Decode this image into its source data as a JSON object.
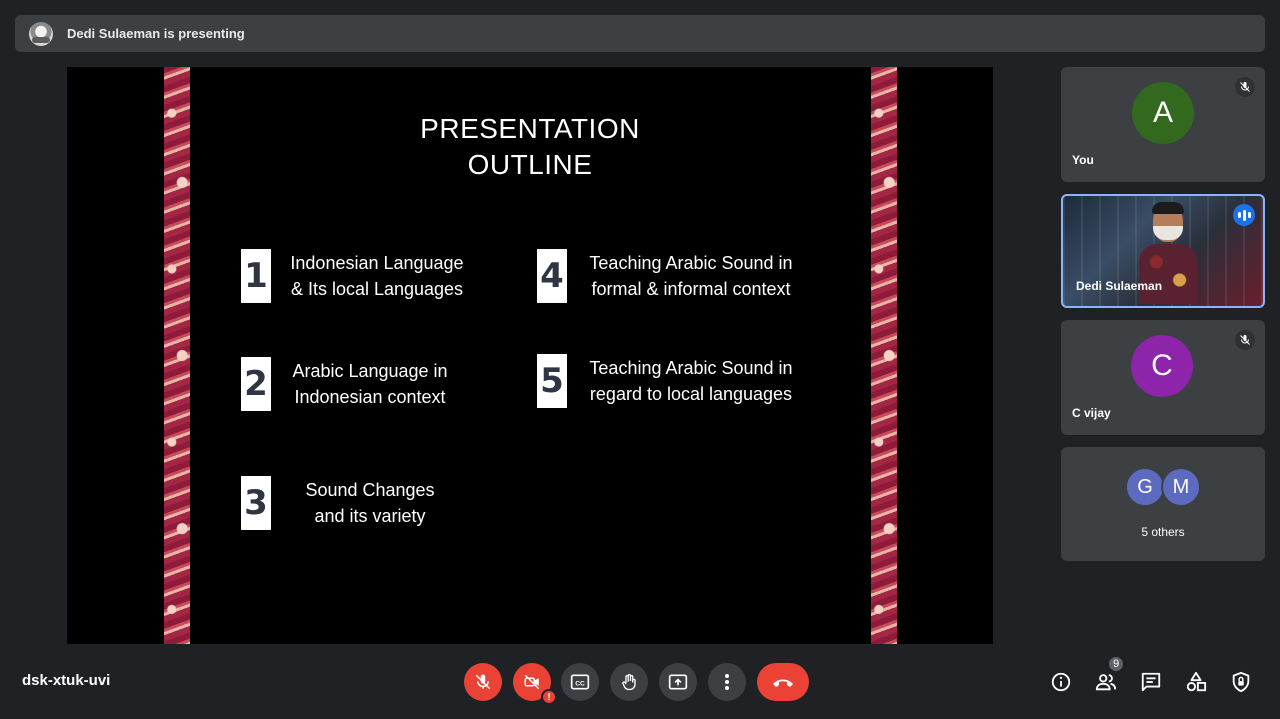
{
  "presenting_bar": {
    "text": "Dedi Sulaeman is presenting"
  },
  "slide": {
    "title_line1": "PRESENTATION",
    "title_line2": "OUTLINE",
    "items": [
      {
        "number": "1",
        "line1": "Indonesian Language",
        "line2": "& Its local Languages"
      },
      {
        "number": "2",
        "line1": "Arabic Language in",
        "line2": "Indonesian context"
      },
      {
        "number": "3",
        "line1": "Sound Changes",
        "line2": "and its variety"
      },
      {
        "number": "4",
        "line1": "Teaching Arabic Sound in",
        "line2": "formal & informal context"
      },
      {
        "number": "5",
        "line1": "Teaching Arabic Sound in",
        "line2": "regard to local languages"
      }
    ]
  },
  "participants": [
    {
      "name": "You",
      "initial": "A",
      "avatar_color": "#33691e",
      "muted": true
    },
    {
      "name": "Dedi Sulaeman",
      "video": true,
      "speaking": true
    },
    {
      "name": "C vijay",
      "initial": "C",
      "avatar_color": "#8e24aa",
      "muted": true
    },
    {
      "name": "5 others",
      "initials": [
        "G",
        "M"
      ],
      "avatar_colors": [
        "#5c6bc0",
        "#5c6bc0"
      ]
    }
  ],
  "bottom_bar": {
    "meeting_code": "dsk-xtuk-uvi",
    "camera_alert": "!",
    "people_count": "9"
  },
  "colors": {
    "end_call": "#ea4335",
    "control_bg": "#3c4043",
    "accent": "#1a73e8"
  }
}
